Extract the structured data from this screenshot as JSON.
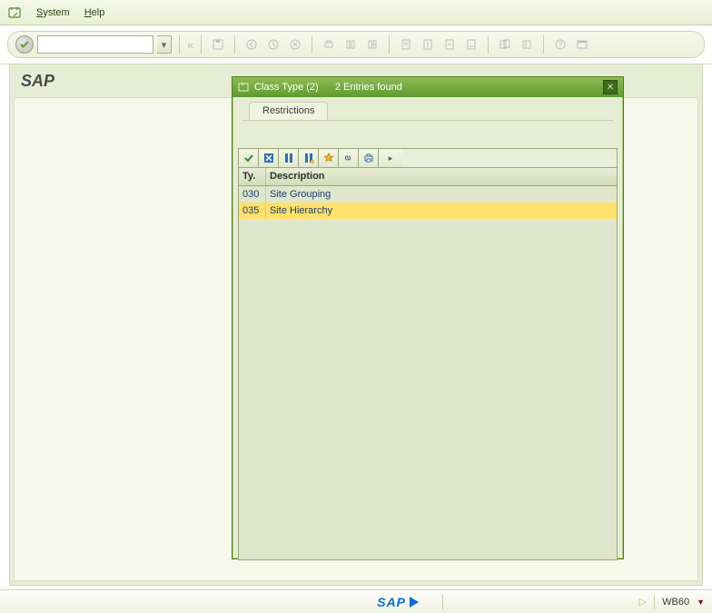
{
  "menu": {
    "system": "System",
    "help": "Help"
  },
  "page": {
    "title": "SAP"
  },
  "dialog": {
    "title_prefix": "Class Type (2)",
    "entries_found": "2 Entries found",
    "tab_restrictions": "Restrictions",
    "columns": {
      "ty": "Ty.",
      "description": "Description"
    },
    "rows": [
      {
        "ty": "030",
        "desc": "Site Grouping",
        "highlight": false
      },
      {
        "ty": "035",
        "desc": "Site Hierarchy",
        "highlight": true
      }
    ]
  },
  "status": {
    "sap": "SAP",
    "tcode": "WB60"
  }
}
